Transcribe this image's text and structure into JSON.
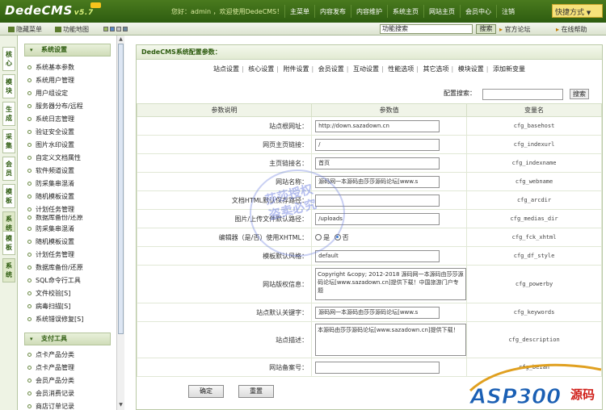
{
  "app": {
    "logo_text": "DedeCMS",
    "logo_version": "v5.7"
  },
  "topbar": {
    "welcome": "您好：admin ，欢迎使用DedeCMS！",
    "nav": [
      "主菜单",
      "内容发布",
      "内容维护",
      "系统主页",
      "网站主页",
      "会员中心",
      "注销"
    ],
    "quick_menu": "快捷方式"
  },
  "subbar": {
    "hide_menu": "隐藏菜单",
    "site_map": "功能地图",
    "colors": [
      "#9dbb61",
      "#5a8ac6",
      "#c4c4c4",
      "#6d8b9e"
    ],
    "search_value": "功能搜索",
    "search_button": "搜索",
    "official_forum": "官方论坛",
    "online_help": "在线帮助"
  },
  "left_tabs": [
    "核心",
    "模块",
    "生成",
    "采集",
    "会员",
    "模板",
    "系统",
    "模板",
    "系统"
  ],
  "sidebar": {
    "group1": "系统设置",
    "items1": [
      "系统基本参数",
      "系统用户管理",
      "用户组设定",
      "服务器分布/远程",
      "系统日志管理",
      "验证安全设置",
      "图片水印设置",
      "自定义文档属性",
      "软件频道设置",
      "防采集串混淆",
      "随机模板设置",
      "计划任务管理",
      "数据库备份/还原",
      "防采集串混淆",
      "随机模板设置",
      "计划任务管理",
      "数据库备份/还原",
      "SQL命令行工具",
      "文件校验[S]",
      "病毒扫描[S]",
      "系统错误修复[S]"
    ],
    "group2": "支付工具",
    "items2": [
      "点卡产品分类",
      "点卡产品管理",
      "会员产品分类",
      "会员消费记录",
      "商店订单记录"
    ]
  },
  "main": {
    "title": "DedeCMS系统配置参数：",
    "tabs": [
      "站点设置",
      "核心设置",
      "附件设置",
      "会员设置",
      "互动设置",
      "性能选项",
      "其它选项",
      "模块设置",
      "添加新变量"
    ],
    "cfg_search_label": "配置搜索：",
    "cfg_search_button": "搜索",
    "headers": [
      "参数说明",
      "参数值",
      "变量名"
    ],
    "rows": [
      {
        "label": "站点根网址：",
        "value": "http://down.sazadown.cn",
        "var": "cfg_basehost"
      },
      {
        "label": "网页主页链接：",
        "value": "/",
        "var": "cfg_indexurl"
      },
      {
        "label": "主页链接名：",
        "value": "首页",
        "var": "cfg_indexname"
      },
      {
        "label": "网站名称：",
        "value": "源码网一本源码由莎莎源码论坛[www.s",
        "var": "cfg_webname"
      },
      {
        "label": "文档HTML默认保存路径：",
        "value": "",
        "var": "cfg_arcdir"
      },
      {
        "label": "图片/上传文件默认路径：",
        "value": "/uploads",
        "var": "cfg_medias_dir"
      },
      {
        "label": "编辑器（是/否）使用XHTML：",
        "value": "",
        "var": "cfg_fck_xhtml"
      },
      {
        "label": "模板默认风格：",
        "value": "default",
        "var": "cfg_df_style"
      },
      {
        "label": "网站版权信息：",
        "value": "Copyright &copy; 2012-2018 源码网一本源码由莎莎源码论坛[www.sazadown.cn]提供下载！中国旅游门户专题",
        "var": "cfg_powerby"
      },
      {
        "label": "站点默认关键字：",
        "value": "源码网一本源码由莎莎源码论坛[www.s",
        "var": "cfg_keywords"
      },
      {
        "label": "站点描述：",
        "value": "本源码由莎莎源码论坛[www.sazadown.cn]提供下载！",
        "var": "cfg_description"
      },
      {
        "label": "网站备案号：",
        "value": "",
        "var": "cfg_beian"
      }
    ],
    "radio_yes": "是",
    "radio_no": "否",
    "xhtml_selected": "否",
    "ok_button": "确定",
    "reset_button": "重置"
  },
  "stamp": {
    "line1": "莎莎授权",
    "line2": "盗卖必究"
  },
  "watermark": {
    "text": "ASP300",
    "suffix": "源码"
  }
}
